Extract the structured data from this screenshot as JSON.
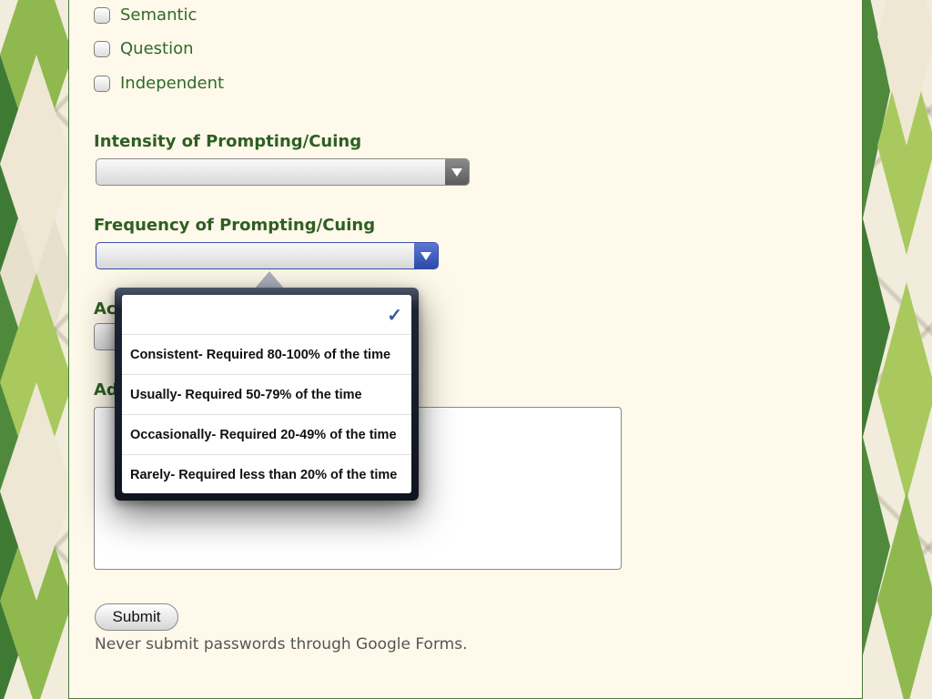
{
  "checkboxes": [
    {
      "label": "Semantic",
      "checked": false
    },
    {
      "label": "Question",
      "checked": false
    },
    {
      "label": "Independent",
      "checked": false
    }
  ],
  "questions": {
    "intensity": {
      "label": "Intensity of Prompting/Cuing",
      "value": ""
    },
    "frequency": {
      "label": "Frequency of Prompting/Cuing",
      "value": ""
    },
    "accuracy_partial": {
      "label": "Ac"
    },
    "additional_partial": {
      "label": "Ad"
    }
  },
  "dropdown": {
    "selected_index": 0,
    "options": [
      "",
      "Consistent- Required 80-100% of the time",
      "Usually- Required 50-79% of the time",
      "Occasionally- Required 20-49% of the time",
      "Rarely- Required less than 20% of the time"
    ],
    "check_glyph": "✓"
  },
  "form": {
    "submit_label": "Submit",
    "password_note": "Never submit passwords through Google Forms."
  },
  "colors": {
    "label_green": "#2e5f22",
    "panel_bg": "#fef9ea",
    "accent_blue": "#2f4aa8"
  }
}
